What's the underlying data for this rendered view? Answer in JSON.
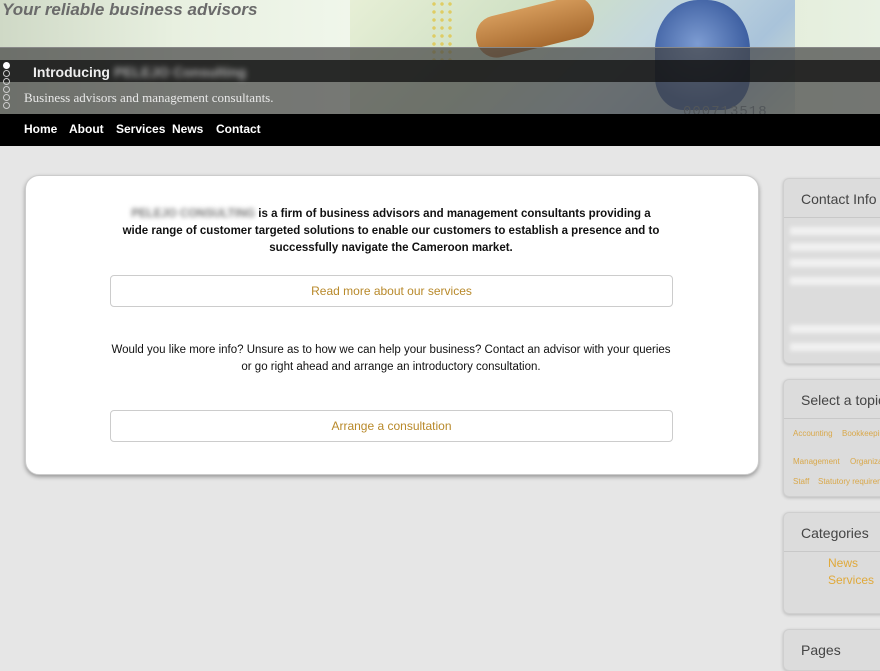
{
  "header": {
    "tagline": "Your reliable business advisors",
    "slide_title": "Introducing",
    "slide_title_blurred": "PELEJO Consulting",
    "slide_subtitle": "Business advisors and management consultants.",
    "banknote_serial": "000713518"
  },
  "nav": {
    "items": [
      "Home",
      "About",
      "Services",
      "News",
      "Contact"
    ]
  },
  "main": {
    "company_name_blurred": "PELEJO CONSULTING",
    "intro_text": "is a firm of business advisors and management consultants providing a wide range of customer targeted solutions to enable our customers to establish a presence and to successfully navigate the Cameroon market.",
    "read_more_label": "Read more about our services",
    "more_info_text": "Would you like more info? Unsure as to how we can help your business? Contact an advisor with your queries or go right ahead and arrange an introductory consultation.",
    "consult_label": "Arrange a consultation"
  },
  "sidebar": {
    "contact_title": "Contact Info",
    "topic_title": "Select a topic",
    "topics": [
      "Accounting",
      "Bookkeeping",
      "Management",
      "Organization",
      "Staff",
      "Statutory requirements"
    ],
    "categories_title": "Categories",
    "categories": [
      "News",
      "Services"
    ],
    "pages_title": "Pages"
  },
  "colors": {
    "accent": "#b8892a",
    "link_orange": "#e0a93a",
    "nav_bg": "#000000"
  }
}
